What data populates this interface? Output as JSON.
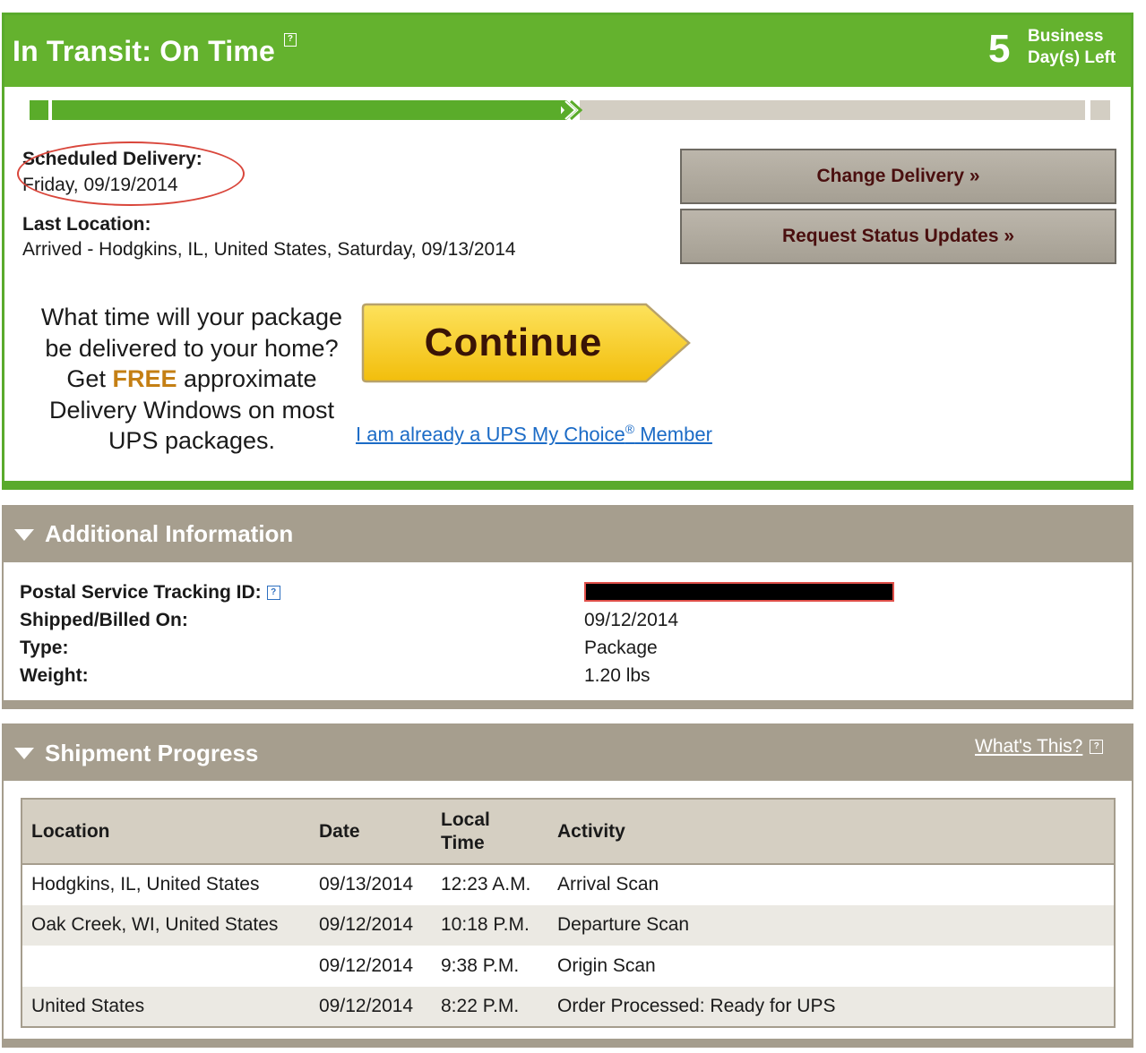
{
  "status": {
    "title": "In Transit: On Time",
    "help_glyph": "?",
    "days_number": "5",
    "days_label_line1": "Business",
    "days_label_line2": "Day(s) Left",
    "progress_fraction": 0.5
  },
  "delivery": {
    "scheduled_label": "Scheduled Delivery:",
    "scheduled_value": "Friday, 09/19/2014",
    "last_location_label": "Last Location:",
    "last_location_value": "Arrived - Hodgkins, IL, United States, Saturday, 09/13/2014"
  },
  "buttons": {
    "change_delivery": "Change Delivery »",
    "request_updates": "Request Status Updates »"
  },
  "promo": {
    "line1": "What time will your package",
    "line2": "be delivered to your home?",
    "line3_pre": "Get ",
    "line3_free": "FREE",
    "line3_post": " approximate",
    "line4": "Delivery Windows on most",
    "line5": "UPS packages.",
    "continue_label": "Continue",
    "member_link_pre": "I am already a UPS My Choice",
    "member_link_reg": "®",
    "member_link_post": " Member"
  },
  "additional": {
    "title": "Additional Information",
    "rows": [
      {
        "label": "Postal Service Tracking ID:",
        "value": ""
      },
      {
        "label": "Shipped/Billed On:",
        "value": "09/12/2014"
      },
      {
        "label": "Type:",
        "value": "Package"
      },
      {
        "label": "Weight:",
        "value": "1.20 lbs"
      }
    ]
  },
  "shipment": {
    "title": "Shipment Progress",
    "whats_this": "What's This?",
    "headers": {
      "location": "Location",
      "date": "Date",
      "time_line1": "Local",
      "time_line2": "Time",
      "activity": "Activity"
    },
    "rows": [
      {
        "location": "Hodgkins, IL, United States",
        "date": "09/13/2014",
        "time": "12:23 A.M.",
        "activity": "Arrival Scan"
      },
      {
        "location": "Oak Creek, WI, United States",
        "date": "09/12/2014",
        "time": "10:18 P.M.",
        "activity": "Departure Scan"
      },
      {
        "location": "",
        "date": "09/12/2014",
        "time": "9:38 P.M.",
        "activity": "Origin Scan"
      },
      {
        "location": "United States",
        "date": "09/12/2014",
        "time": "8:22 P.M.",
        "activity": "Order Processed: Ready for UPS"
      }
    ]
  },
  "colors": {
    "status_green": "#64b22e",
    "section_brown": "#a69e8e",
    "button_text": "#4a0f0f",
    "continue_yellow": "#f7cb14",
    "link_blue": "#1b6bc6",
    "free_orange": "#c47f14",
    "annotation_red": "#d9463b"
  }
}
